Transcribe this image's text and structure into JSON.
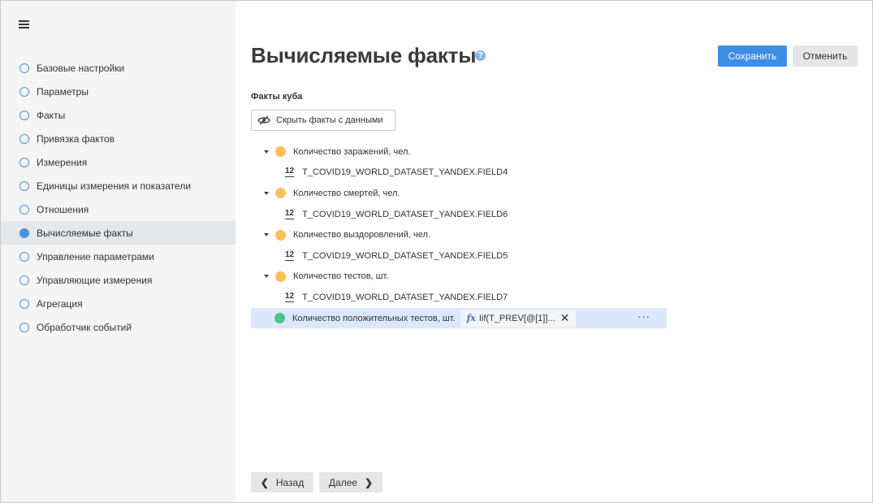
{
  "page": {
    "title": "Вычисляемые факты",
    "help_icon": "?",
    "save_label": "Сохранить",
    "cancel_label": "Отменить",
    "section_label": "Факты куба",
    "hide_facts_label": "Скрыть факты с данными",
    "back_label": "Назад",
    "next_label": "Далее"
  },
  "sidebar": {
    "menu_icon": "hamburger-icon",
    "active_index": 7,
    "items": [
      {
        "label": "Базовые настройки"
      },
      {
        "label": "Параметры"
      },
      {
        "label": "Факты"
      },
      {
        "label": "Привязка фактов"
      },
      {
        "label": "Измерения"
      },
      {
        "label": "Единицы измерения и показатели"
      },
      {
        "label": "Отношения"
      },
      {
        "label": "Вычисляемые факты"
      },
      {
        "label": "Управление параметрами"
      },
      {
        "label": "Управляющие измерения"
      },
      {
        "label": "Агрегация"
      },
      {
        "label": "Обработчик событий"
      }
    ]
  },
  "tree": {
    "field_icon_label": "12",
    "facts": [
      {
        "label": "Количество заражений, чел.",
        "field": "T_COVID19_WORLD_DATASET_YANDEX.FIELD4"
      },
      {
        "label": "Количество смертей, чел.",
        "field": "T_COVID19_WORLD_DATASET_YANDEX.FIELD6"
      },
      {
        "label": "Количество выздоровлений, чел.",
        "field": "T_COVID19_WORLD_DATASET_YANDEX.FIELD5"
      },
      {
        "label": "Количество тестов, шт.",
        "field": "T_COVID19_WORLD_DATASET_YANDEX.FIELD7"
      }
    ],
    "calculated": {
      "label": "Количество положительных тестов, шт.",
      "fx_label": "fx",
      "formula": "Iif(T_PREV[@[1]]...",
      "clear_icon": "✕",
      "more_icon": "···"
    }
  },
  "colors": {
    "accent": "#3e8ee8",
    "fact_dot": "#fbbf5a",
    "calculated_dot": "#4cc48e",
    "selected_row": "#dbe8fb",
    "sidebar_bg": "#f5f5f5"
  }
}
